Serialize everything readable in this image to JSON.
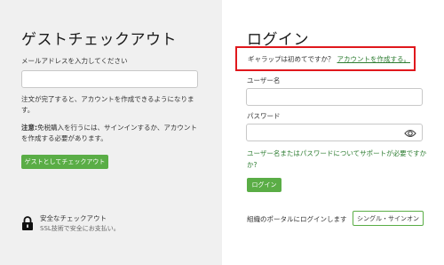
{
  "guest": {
    "title": "ゲストチェックアウト",
    "email_label": "メールアドレスを入力してください",
    "email_value": "",
    "note_line1": "注文が完了すると、アカウントを作成できるようになりま",
    "note_line2": "す。",
    "attention_bold": "注意:",
    "attention_line1_rest": "免税購入を行うには、サインインするか、アカウント",
    "attention_line2": "を作成する必要があります。",
    "button_label": "ゲストとしてチェックアウト",
    "secure_title": "安全なチェックアウト",
    "secure_sub": "SSL技術で安全にお支払い。",
    "lock_icon": "lock-icon"
  },
  "login": {
    "title": "ログイン",
    "callout_text": "ギャラップは初めてですか？",
    "callout_link": "アカウントを作成する。",
    "username_label": "ユーザー名",
    "username_value": "",
    "password_label": "パスワード",
    "password_value": "",
    "eye_icon": "eye-icon",
    "help_line1": "ユーザー名またはパスワードについてサポートが必要ですか",
    "help_line2": "か?",
    "button_label": "ログイン",
    "portal_text": "組織のポータルにログインします",
    "sso_label": "シングル・サインオン"
  },
  "colors": {
    "accent": "#5aad46",
    "link": "#2e7d32",
    "highlight_border": "#e0181d",
    "left_bg": "#f0f0f0"
  }
}
